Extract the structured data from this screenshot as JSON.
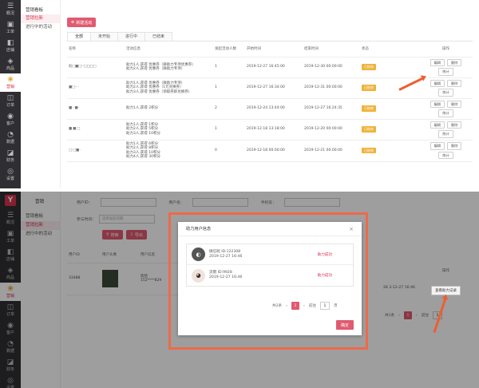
{
  "top": {
    "rail": [
      {
        "icon": "☰",
        "label": "概况"
      },
      {
        "icon": "▣",
        "label": "工单"
      },
      {
        "icon": "◧",
        "label": "店铺"
      },
      {
        "icon": "◈",
        "label": "商品"
      },
      {
        "icon": "❀",
        "label": "营销",
        "active": true
      },
      {
        "icon": "◫",
        "label": "订单"
      },
      {
        "icon": "◉",
        "label": "客户"
      },
      {
        "icon": "◔",
        "label": "数据"
      },
      {
        "icon": "◪",
        "label": "财务"
      },
      {
        "icon": "◎",
        "label": "设置"
      }
    ],
    "subnav": {
      "title": "营销看板",
      "items": [
        "营销拉新",
        "进行中的活动"
      ]
    },
    "new_button": "新建活动",
    "tabs": [
      "全部",
      "未开始",
      "进行中",
      "已结束"
    ],
    "columns": [
      "名称",
      "活动信息",
      "发起活动人数",
      "开始时间",
      "结束时间",
      "状态",
      "操作"
    ],
    "rows": [
      {
        "name": "助□■□·-□□□□",
        "info": [
          "助力1人,获得 优惠券（微助力专项优惠券）",
          "助力2人,获得 优惠券（微助力专项）"
        ],
        "count": "1",
        "start": "2019-12-27 16:45:00",
        "end": "2019-12-30 00:00:00",
        "status": "已结束",
        "ops": [
          "编辑",
          "删除",
          "统计"
        ]
      },
      {
        "name": "■□·-   ·",
        "info": [
          "助力1人,获得 优惠券（微助力专项）",
          "助力2人,获得 优惠券（1元兑换券）",
          "助力3人,获得 优惠券（领取券即兑换券）"
        ],
        "count": "1",
        "start": "2019-12-27 16:34:00",
        "end": "2019-12-31 00:00:00",
        "status": "已结束",
        "ops": [
          "编辑",
          "删除",
          "统计"
        ]
      },
      {
        "name": "■ -  ■·",
        "info": [
          "助力1人,获得 2积分"
        ],
        "count": "2",
        "start": "2019-12-24 13:44:00",
        "end": "2019-12-27 16:24:35",
        "status": "已结束",
        "ops": [
          "编辑",
          "删除",
          "统计"
        ]
      },
      {
        "name": "■ ■  □",
        "info": [
          "助力1人,获得 1积分",
          "助力2人,获得 5积分",
          "助力3人,获得 10积分"
        ],
        "count": "1",
        "start": "2019-12-18 13:18:00",
        "end": "2019-12-20 00:00:00",
        "status": "已结束",
        "ops": [
          "编辑",
          "删除",
          "统计"
        ]
      },
      {
        "name": "□·□■ ·",
        "info": [
          "助力1人,获得 6积分",
          "助力2人,获得 8积分",
          "助力3人,获得 10积分",
          "助力4人,获得 30积分"
        ],
        "count": "0",
        "start": "2019-12-18 00:00:00",
        "end": "2019-12-21 00:00:00",
        "status": "已结束",
        "ops": [
          "编辑",
          "删除",
          "统计"
        ]
      }
    ]
  },
  "bottom": {
    "logo": "Y",
    "rail": [
      {
        "icon": "☰",
        "label": "概况"
      },
      {
        "icon": "▣",
        "label": "工单"
      },
      {
        "icon": "◧",
        "label": "店铺"
      },
      {
        "icon": "◈",
        "label": "商品"
      },
      {
        "icon": "❀",
        "label": "营销",
        "active": true
      },
      {
        "icon": "◫",
        "label": "订单"
      },
      {
        "icon": "◉",
        "label": "客户"
      },
      {
        "icon": "◔",
        "label": "数据"
      },
      {
        "icon": "◪",
        "label": "财务"
      },
      {
        "icon": "◎",
        "label": "设置"
      }
    ],
    "subnav": {
      "title": "营销",
      "items": [
        "营销看板",
        "营销拉新",
        "进行中的活动"
      ]
    },
    "filters": {
      "user_id": "用户ID：",
      "user_name": "用户名：",
      "phone": "手机号："
    },
    "select": {
      "label": "参与时间：",
      "placeholder": "选择发起日期"
    },
    "btn_search": "搜索",
    "btn_export": "导出",
    "columns": [
      "用户ID",
      "用户头像",
      "用户信息"
    ],
    "row": {
      "uid": "33488",
      "name": "欢恰",
      "phone": "152****829"
    },
    "right_time": "28 3-12-27 16:46",
    "right_op_header": "操作",
    "view_button": "查看助力记录",
    "right_pager": {
      "total": "共1条",
      "page": "1",
      "goto": "前往",
      "goto_val": "1"
    },
    "modal": {
      "title": "助力用户信息",
      "close": "×",
      "rows": [
        {
          "avatar": "◐",
          "name": "微信昵 ID:122308",
          "time": "2019-12-27 16:46",
          "status": "助力成功"
        },
        {
          "avatar": "◕",
          "name": "流雨 ID:9928",
          "time": "2019-12-27 16:46",
          "status": "助力成功"
        }
      ],
      "pager": {
        "total": "共2条",
        "prev": "‹",
        "page": "1",
        "next": "›",
        "goto": "前往",
        "goto_val": "1",
        "unit": "页"
      },
      "ok": "确定"
    }
  }
}
